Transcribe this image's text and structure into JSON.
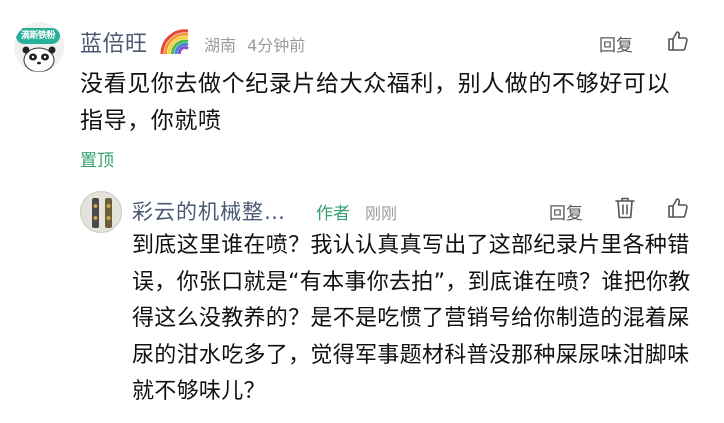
{
  "comment": {
    "avatar_badge": "滴斯铁粉",
    "username": "蓝倍旺",
    "username_icon": "rainbow-icon",
    "location": "湖南",
    "time": "4分钟前",
    "reply_label": "回复",
    "like_icon": "thumbs-up-icon",
    "body": "没看见你去做个纪录片给大众福利，别人做的不够好可以指导，你就喷",
    "pin_label": "置顶"
  },
  "reply": {
    "avatar_icon": "avatar-image",
    "username": "彩云的机械整…",
    "author_badge": "作者",
    "time": "刚刚",
    "reply_label": "回复",
    "delete_icon": "trash-icon",
    "like_icon": "thumbs-up-icon",
    "body": "到底这里谁在喷？我认认真真写出了这部纪录片里各种错误，你张口就是“有本事你去拍”，到底谁在喷？谁把你教得这么没教养的？是不是吃惯了营销号给你制造的混着屎尿的泔水吃多了，觉得军事题材科普没那种屎尿味泔脚味就不够味儿？"
  },
  "colors": {
    "username": "#4a5a75",
    "meta": "#9b9b9b",
    "accent_green": "#35a070",
    "text": "#111111"
  }
}
